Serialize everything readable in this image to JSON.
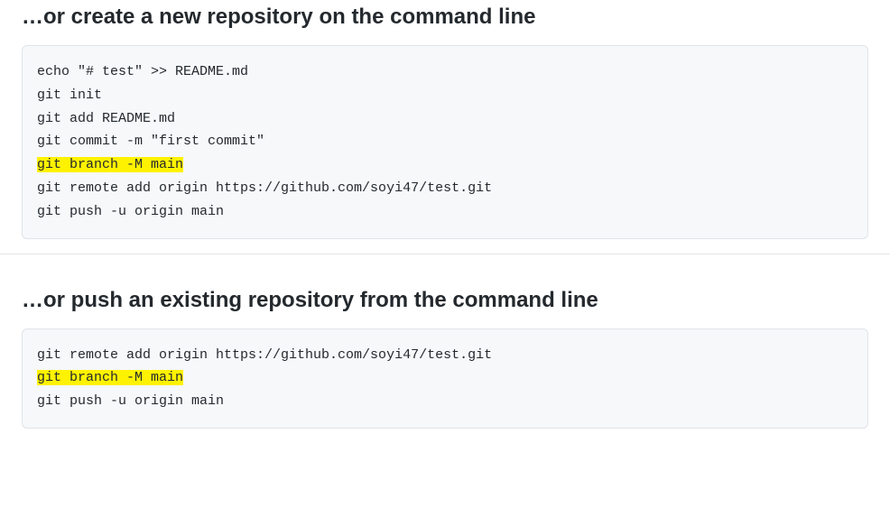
{
  "sections": [
    {
      "heading": "…or create a new repository on the command line",
      "code_lines": [
        {
          "text": "echo \"# test\" >> README.md",
          "highlight": false
        },
        {
          "text": "git init",
          "highlight": false
        },
        {
          "text": "git add README.md",
          "highlight": false
        },
        {
          "text": "git commit -m \"first commit\"",
          "highlight": false
        },
        {
          "text": "git branch -M main",
          "highlight": true
        },
        {
          "text": "git remote add origin https://github.com/soyi47/test.git",
          "highlight": false
        },
        {
          "text": "git push -u origin main",
          "highlight": false
        }
      ]
    },
    {
      "heading": "…or push an existing repository from the command line",
      "code_lines": [
        {
          "text": "git remote add origin https://github.com/soyi47/test.git",
          "highlight": false
        },
        {
          "text": "git branch -M main",
          "highlight": true
        },
        {
          "text": "git push -u origin main",
          "highlight": false
        }
      ]
    }
  ]
}
